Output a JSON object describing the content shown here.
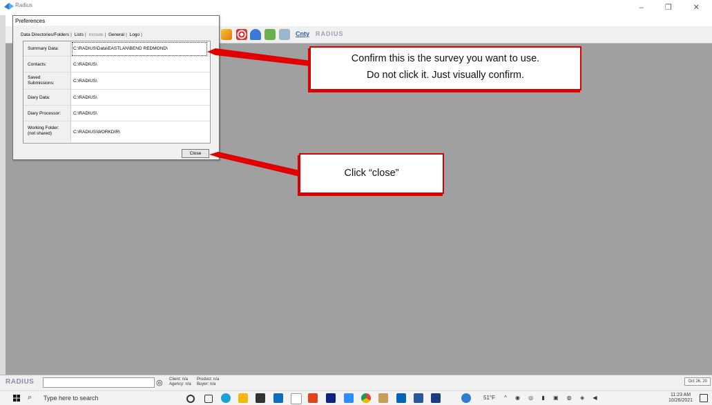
{
  "app": {
    "title": "Radius",
    "window_controls": "–  ❐  ✕"
  },
  "toolbar": {
    "brand_text": "RADIUS",
    "cnty_label": "Cnty"
  },
  "dialog": {
    "title": "Preferences",
    "tabs": [
      {
        "label": "Data Directories/Folders",
        "active": true
      },
      {
        "label": "Lists",
        "active": false
      },
      {
        "label": "Include",
        "disabled": true
      },
      {
        "label": "General",
        "active": false
      },
      {
        "label": "Logo",
        "active": false
      }
    ],
    "rows": [
      {
        "label": "Summary Data:",
        "value": "C:\\RADIUS\\Data\\EASTLAN\\BEND REDMOND\\"
      },
      {
        "label": "Contacts:",
        "value": "C:\\RADIUS\\"
      },
      {
        "label": "Saved Submissions:",
        "value": "C:\\RADIUS\\"
      },
      {
        "label": "Diary Data:",
        "value": "C:\\RADIUS\\"
      },
      {
        "label": "Diary Processor:",
        "value": "C:\\RADIUS\\"
      },
      {
        "label": "Working Folder: (not shared)",
        "value": "C:\\RADIUS\\WORKDIR\\"
      }
    ],
    "close_label": "Close"
  },
  "callouts": {
    "confirm_line1": "Confirm this is the survey you want to use.",
    "confirm_line2": "Do not click it. Just visually confirm.",
    "close_instruction": "Click “close”"
  },
  "statusbar": {
    "logo": "RADIUS",
    "client": "Client: n/a",
    "agency": "Agency: n/a",
    "product": "Product: n/a",
    "buyer": "Buyer: n/a",
    "date": "Oct 26, 20"
  },
  "taskbar": {
    "search_placeholder": "Type here to search",
    "weather": "51°F",
    "time": "11:23 AM",
    "date": "10/26/2021"
  },
  "colors": {
    "workarea": "#a0a0a0",
    "callout_border": "#d90000",
    "arrow": "#e00000"
  }
}
